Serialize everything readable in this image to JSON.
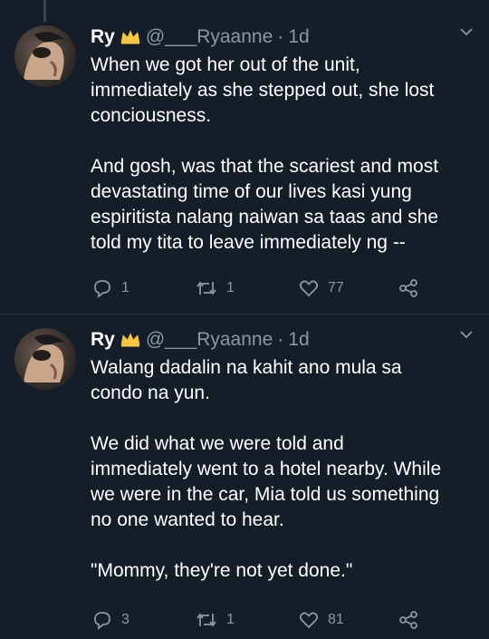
{
  "tweets": [
    {
      "name": "Ry",
      "handle": "@___Ryaanne",
      "separator": "·",
      "time": "1d",
      "paragraphs": [
        "When we got her out of the unit,\nimmediately as she stepped out, she lost\nconciousness.",
        "And gosh, was that the scariest and most\ndevastating time of our lives kasi yung\nespiritista nalang naiwan sa taas and she\ntold my tita to leave immediately ng --"
      ],
      "replies": "1",
      "retweets": "1",
      "likes": "77"
    },
    {
      "name": "Ry",
      "handle": "@___Ryaanne",
      "separator": "·",
      "time": "1d",
      "paragraphs": [
        "Walang dadalin na kahit ano mula sa\ncondo na yun.",
        "We did what we were told and\nimmediately went to a hotel nearby. While\nwe were in the car, Mia told us something\nno one wanted to hear.",
        "\"Mommy, they're not yet done.\""
      ],
      "replies": "3",
      "retweets": "1",
      "likes": "81"
    }
  ],
  "icons": {
    "badge": "crown-icon",
    "menu": "chevron-down-icon",
    "reply": "reply-icon",
    "retweet": "retweet-icon",
    "like": "heart-icon",
    "share": "share-icon"
  },
  "colors": {
    "background": "#151d29",
    "text": "#ffffff",
    "secondary": "#8899a6",
    "crown": "#f2c84b"
  }
}
